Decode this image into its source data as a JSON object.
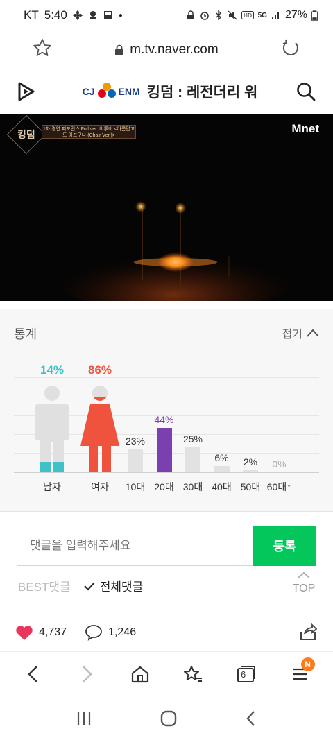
{
  "status_bar": {
    "carrier": "KT",
    "time": "5:40",
    "battery": "27%",
    "network": "5G"
  },
  "browser": {
    "url": "m.tv.naver.com"
  },
  "header": {
    "brand": "CJ ENM",
    "title": "킹덤 : 레전더리 워"
  },
  "video": {
    "channel": "Mnet",
    "badge": "킹덤",
    "caption": "1차 경연 퍼포먼스 Full ver. 비투비 <아름답고도 아프구나 (Chair Ver.)>"
  },
  "stats": {
    "title": "통계",
    "collapse_label": "접기",
    "gender": [
      {
        "label": "남자",
        "percent": "14%",
        "value": 14,
        "color": "#3fc1c9"
      },
      {
        "label": "여자",
        "percent": "86%",
        "value": 86,
        "color": "#f0533d"
      }
    ],
    "ages": [
      {
        "label": "10대",
        "percent": "23%",
        "value": 23
      },
      {
        "label": "20대",
        "percent": "44%",
        "value": 44
      },
      {
        "label": "30대",
        "percent": "25%",
        "value": 25
      },
      {
        "label": "40대",
        "percent": "6%",
        "value": 6
      },
      {
        "label": "50대",
        "percent": "2%",
        "value": 2
      },
      {
        "label": "60대↑",
        "percent": "0%",
        "value": 0
      }
    ],
    "highlight_age_index": 1,
    "highlight_color": "#7b3fb0",
    "bar_color": "#e2e2e2"
  },
  "comments": {
    "placeholder": "댓글을 입력해주세요",
    "submit_label": "등록",
    "tab_best": "BEST댓글",
    "tab_all": "전체댓글",
    "top_label": "TOP"
  },
  "actions": {
    "likes": "4,737",
    "comments": "1,246"
  },
  "nav": {
    "tabs_count": "6",
    "notification_badge": "N"
  }
}
